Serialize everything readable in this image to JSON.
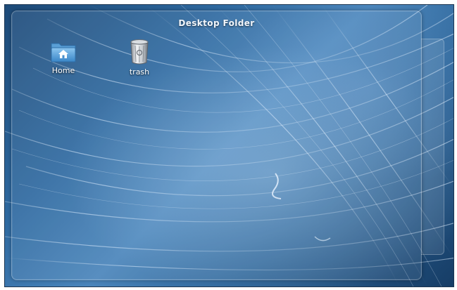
{
  "desktop": {
    "wallpaper_colors": [
      "#163d66",
      "#2f6aa1",
      "#4a85bb",
      "#a0c8eb"
    ]
  },
  "folder_window": {
    "title": "Desktop Folder"
  },
  "icons": [
    {
      "label": "Home",
      "icon": "home-folder-icon"
    },
    {
      "label": "trash",
      "icon": "trash-can-icon"
    }
  ]
}
